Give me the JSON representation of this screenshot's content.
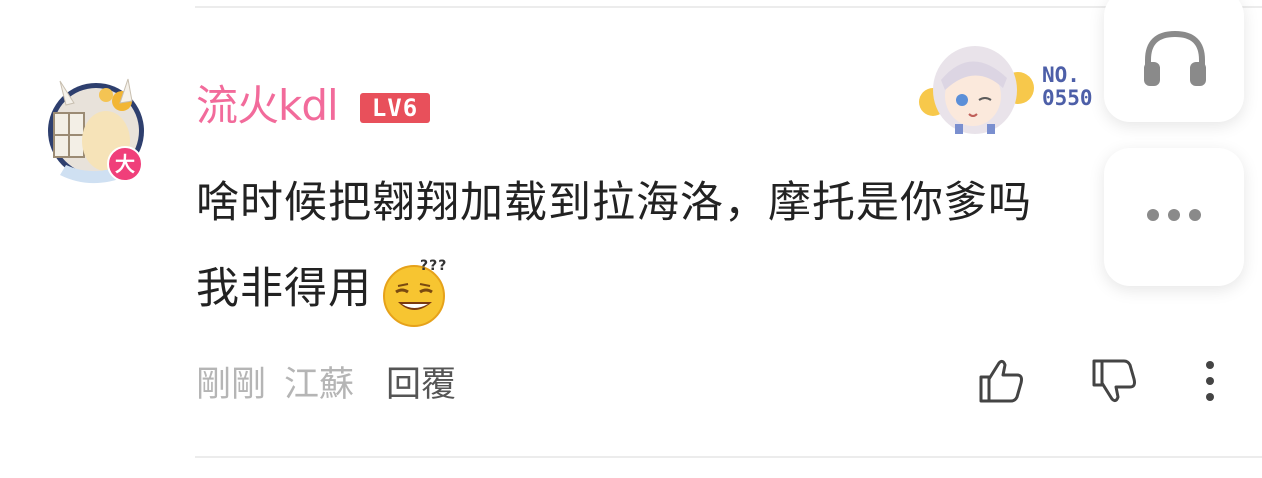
{
  "comment": {
    "username": "流火kdl",
    "level": "LV6",
    "avatar_badge": "大",
    "fan_badge_label": "NO.",
    "fan_badge_number": "0550",
    "text_line1": "啥时候把翱翔加载到拉海洛，摩托是你爹吗",
    "text_line2": "我非得用",
    "emoji": "thinking-sweat-emoji",
    "time": "剛剛",
    "location": "江蘇",
    "reply_label": "回覆"
  },
  "icons": {
    "like": "thumbs-up-icon",
    "dislike": "thumbs-down-icon",
    "more": "vertical-ellipsis-icon",
    "headphone": "headphone-icon",
    "float_more": "horizontal-ellipsis-icon"
  },
  "colors": {
    "username": "#f26b9b",
    "level_badge": "#e8505b",
    "fan_number": "#4d5fa8",
    "meta_text": "#b5b5b5",
    "reply_text": "#555555"
  }
}
